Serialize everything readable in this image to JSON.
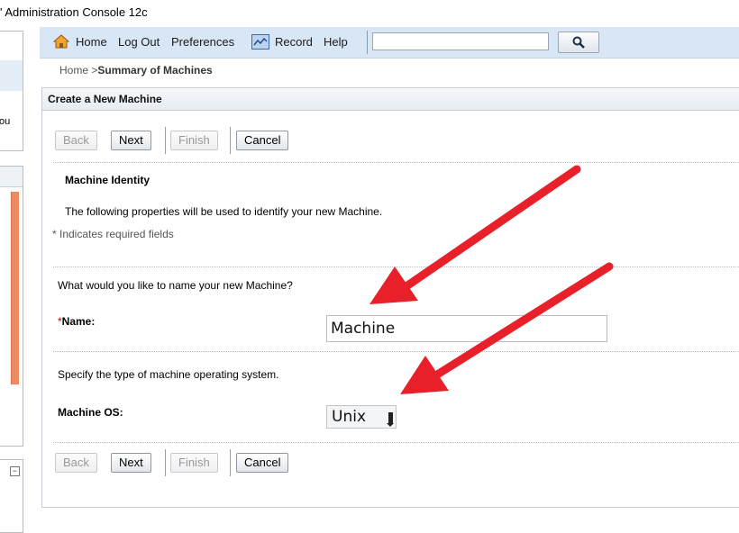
{
  "window": {
    "title": "' Administration Console 12c"
  },
  "left_panels": {
    "text_fragment": "ou"
  },
  "toolbar": {
    "links": [
      "Home",
      "Log Out",
      "Preferences",
      "Record",
      "Help"
    ],
    "search": {
      "value": "",
      "placeholder": ""
    },
    "icons": {
      "home": "home-icon",
      "record": "record-icon",
      "search": "magnifier-icon"
    }
  },
  "breadcrumb": {
    "prefix": "Home >",
    "current": "Summary of Machines"
  },
  "panel": {
    "title": "Create a New Machine"
  },
  "wizard_buttons": {
    "back": "Back",
    "next": "Next",
    "finish": "Finish",
    "cancel": "Cancel"
  },
  "section": {
    "title": "Machine Identity",
    "description": "The following properties will be used to identify your new Machine.",
    "required_note": "* Indicates required fields"
  },
  "name_field": {
    "question": "What would you like to name your new Machine?",
    "required_marker": "*",
    "label": "Name:",
    "value": "Machine"
  },
  "os_field": {
    "question": "Specify the type of machine operating system.",
    "label": "Machine OS:",
    "selected": "Unix"
  },
  "colors": {
    "toolbar_bg": "#d8e6f5",
    "annotation_arrow": "#e8202a",
    "left_scroll": "#ee8a62"
  }
}
